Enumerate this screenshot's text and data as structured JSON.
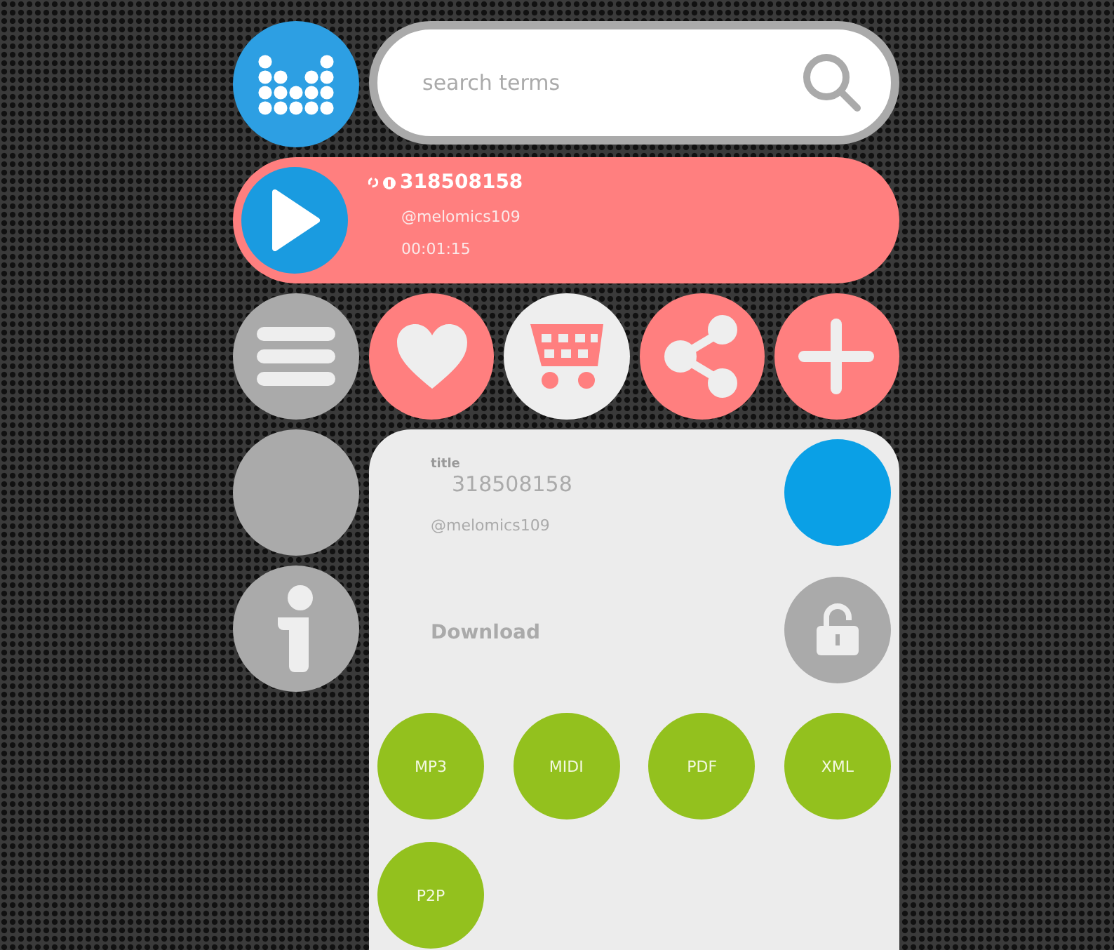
{
  "search": {
    "placeholder": "search terms"
  },
  "player": {
    "title": "318508158",
    "author": "@melomics109",
    "time": "00:01:15"
  },
  "actions": [
    {
      "kind": "heart",
      "selected": false
    },
    {
      "kind": "cart",
      "selected": true
    },
    {
      "kind": "share",
      "selected": false
    },
    {
      "kind": "add",
      "selected": false
    }
  ],
  "details": {
    "title_label": "title",
    "title": "318508158",
    "author": "@melomics109",
    "download_label": "Download",
    "formats": [
      "MP3",
      "MIDI",
      "PDF",
      "XML",
      "P2P"
    ]
  }
}
